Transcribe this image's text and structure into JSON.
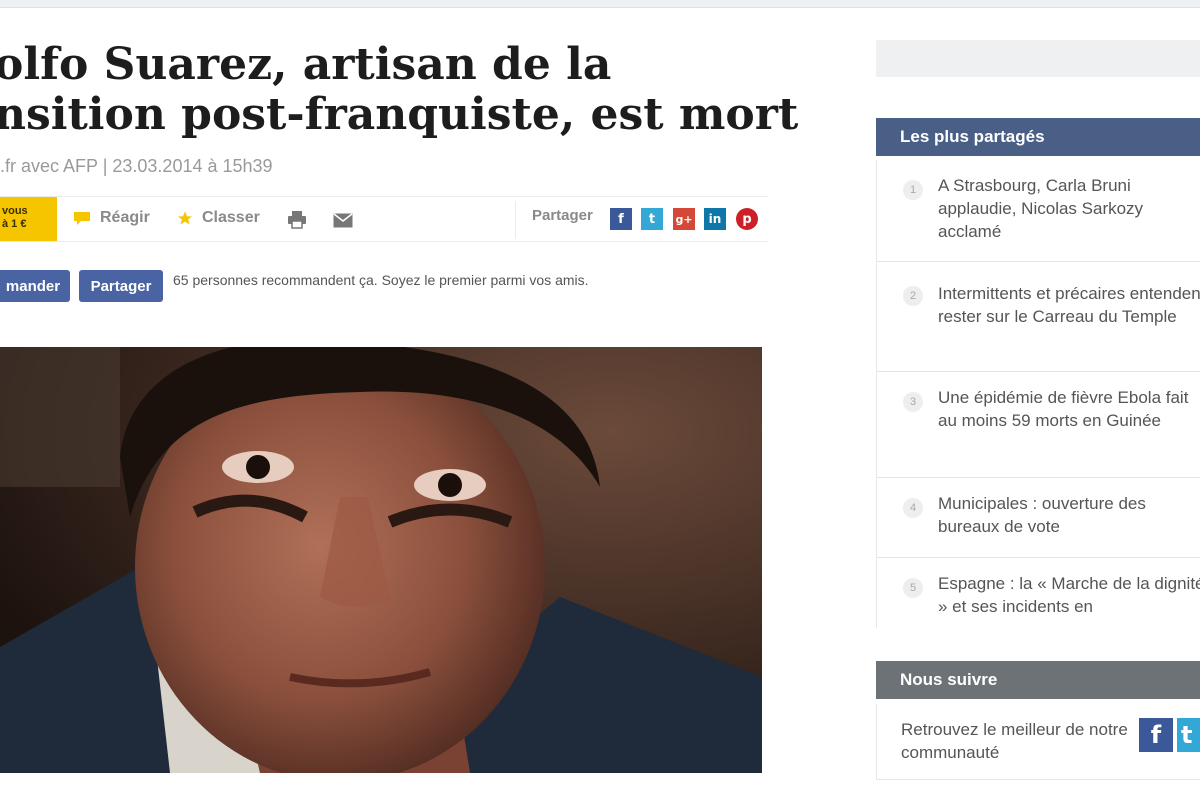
{
  "article": {
    "title_line1": "olfo Suarez, artisan de la",
    "title_line2": "nsition post-franquiste, est mort",
    "byline": ".fr avec AFP | 23.03.2014 à 15h39"
  },
  "toolbar": {
    "promo_line1": "vous",
    "promo_line2": "à 1 €",
    "react_label": "Réagir",
    "save_label": "Classer",
    "share_label": "Partager",
    "icons": [
      "comment-icon",
      "star-icon",
      "print-icon",
      "mail-icon",
      "facebook-icon",
      "twitter-icon",
      "google-plus-icon",
      "linkedin-icon",
      "pinterest-icon"
    ],
    "colors": {
      "promo": "#f5c500",
      "facebook": "#3b5998",
      "twitter": "#33a7d6",
      "gplus": "#d34836",
      "linkedin": "#0e76a8",
      "pinterest": "#cb2027"
    }
  },
  "facebook": {
    "recommend_label": "mander",
    "share_label": "Partager",
    "text": "65 personnes recommandent ça. Soyez le premier parmi vos amis."
  },
  "sidebar": {
    "most_shared_title": "Les plus partagés",
    "items": [
      {
        "num": "1",
        "text": "A Strasbourg, Carla Bruni applaudie, Nicolas Sarkozy acclamé"
      },
      {
        "num": "2",
        "text": "Intermittents et précaires entendent rester sur le Carreau du Temple"
      },
      {
        "num": "3",
        "text": "Une épidémie de fièvre Ebola fait au moins 59 morts en Guinée"
      },
      {
        "num": "4",
        "text": "Municipales : ouverture des bureaux de vote"
      },
      {
        "num": "5",
        "text": "Espagne : la « Marche de la dignité » et ses incidents en"
      }
    ],
    "follow_title": "Nous suivre",
    "follow_text": "Retrouvez le meilleur de notre communauté",
    "follow_icons": [
      "facebook-icon",
      "twitter-icon"
    ],
    "colors": {
      "header_blue": "#4a5f86",
      "header_grey": "#6d7276"
    }
  }
}
